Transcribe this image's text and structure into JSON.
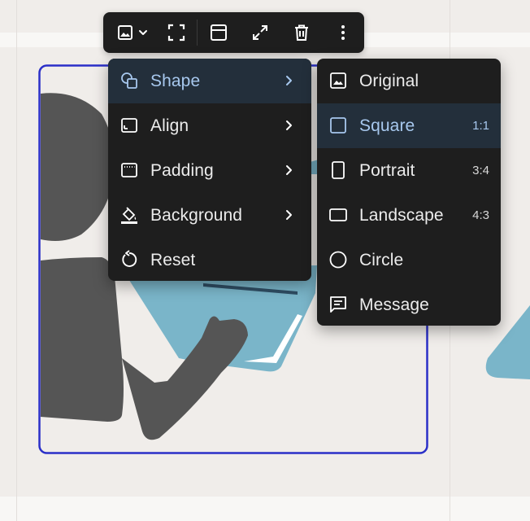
{
  "toolbar": {
    "buttons": [
      {
        "name": "image-type-button",
        "icon": "image-icon",
        "has_dropdown": true
      },
      {
        "name": "crop-button",
        "icon": "crop-frame-icon"
      },
      {
        "name": "layout-button",
        "icon": "layout-panel-icon"
      },
      {
        "name": "expand-button",
        "icon": "expand-arrows-icon"
      },
      {
        "name": "delete-button",
        "icon": "trash-icon"
      },
      {
        "name": "more-button",
        "icon": "more-vertical-icon"
      }
    ]
  },
  "menu": {
    "items": [
      {
        "label": "Shape",
        "icon": "shapes-icon",
        "active": true,
        "submenu": true
      },
      {
        "label": "Align",
        "icon": "align-icon",
        "submenu": true
      },
      {
        "label": "Padding",
        "icon": "padding-icon",
        "submenu": true
      },
      {
        "label": "Background",
        "icon": "paint-bucket-icon",
        "submenu": true
      },
      {
        "label": "Reset",
        "icon": "reset-icon",
        "submenu": false
      }
    ]
  },
  "submenu": {
    "items": [
      {
        "label": "Original",
        "icon": "image-icon",
        "ratio": ""
      },
      {
        "label": "Square",
        "icon": "square-icon",
        "ratio": "1:1",
        "active": true
      },
      {
        "label": "Portrait",
        "icon": "portrait-icon",
        "ratio": "3:4"
      },
      {
        "label": "Landscape",
        "icon": "landscape-icon",
        "ratio": "4:3"
      },
      {
        "label": "Circle",
        "icon": "circle-icon",
        "ratio": ""
      },
      {
        "label": "Message",
        "icon": "message-icon",
        "ratio": ""
      }
    ]
  },
  "colors": {
    "menu_bg": "#1e1e1e",
    "active_bg": "#232f3b",
    "active_text": "#a7c8ee",
    "selection_border": "#2a2fc8",
    "figure": "#555555",
    "laptop": "#7ab5c9"
  }
}
